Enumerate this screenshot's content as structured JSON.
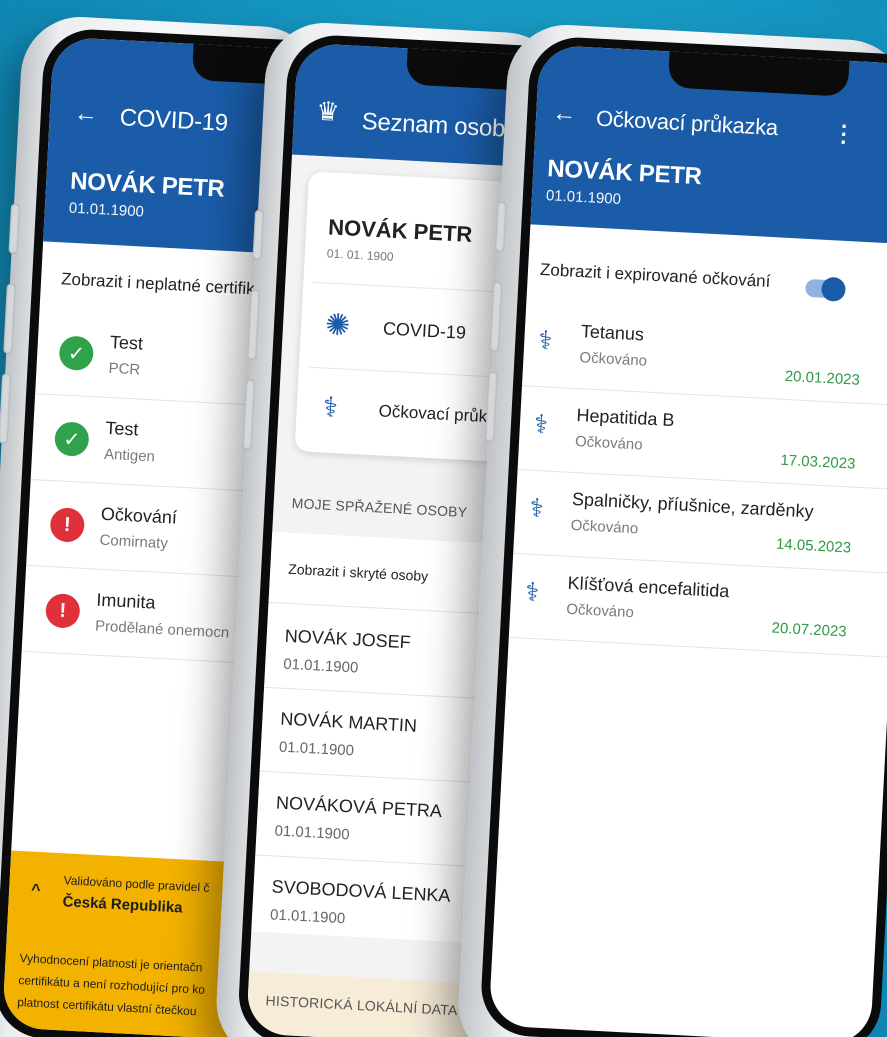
{
  "phone1": {
    "back_icon": "arrow-left-icon",
    "title": "COVID-19",
    "name": "NOVÁK PETR",
    "dob": "01.01.1900",
    "toggle_label": "Zobrazit i neplatné certifik",
    "items": [
      {
        "title": "Test",
        "sub": "PCR",
        "icon": "check-icon",
        "status": "valid"
      },
      {
        "title": "Test",
        "sub": "Antigen",
        "icon": "check-icon",
        "status": "valid"
      },
      {
        "title": "Očkování",
        "sub": "Comirnaty",
        "icon": "warning-icon",
        "status": "invalid"
      },
      {
        "title": "Imunita",
        "sub": "Prodělané onemocn",
        "icon": "warning-icon",
        "status": "invalid"
      }
    ],
    "footer": {
      "chevron": "^",
      "validated_label": "Validováno podle pravidel č",
      "country": "Česká Republika",
      "note_line1": "Vyhodnocení platnosti je orientačn",
      "note_line2": "certifikátu a není rozhodující pro ko",
      "note_line3": "platnost certifikátu vlastní čtečkou"
    }
  },
  "phone2": {
    "logo_icon": "czech-lion-icon",
    "title": "Seznam osob",
    "card": {
      "name": "NOVÁK PETR",
      "dob": "01. 01. 1900",
      "items": [
        {
          "label": "COVID-19",
          "icon": "virus-icon"
        },
        {
          "label": "Očkovací průka",
          "icon": "syringe-icon"
        }
      ]
    },
    "section_linked": "MOJE SPŘAŽENÉ OSOBY",
    "toggle_label": "Zobrazit i skryté osoby",
    "people": [
      {
        "name": "NOVÁK JOSEF",
        "dob": "01.01.1900"
      },
      {
        "name": "NOVÁK MARTIN",
        "dob": "01.01.1900"
      },
      {
        "name": "NOVÁKOVÁ PETRA",
        "dob": "01.01.1900"
      },
      {
        "name": "SVOBODOVÁ LENKA",
        "dob": "01.01.1900"
      }
    ],
    "section_history": "HISTORICKÁ LOKÁLNÍ DATA"
  },
  "phone3": {
    "back_icon": "arrow-left-icon",
    "title": "Očkovací průkazka",
    "menu_icon": "more-vert-icon",
    "name": "NOVÁK PETR",
    "dob": "01.01.1900",
    "toggle_label": "Zobrazit i expirované očkování",
    "toggle_on": true,
    "vaccines": [
      {
        "name": "Tetanus",
        "status": "Očkováno",
        "date": "20.01.2023"
      },
      {
        "name": "Hepatitida B",
        "status": "Očkováno",
        "date": "17.03.2023"
      },
      {
        "name": "Spalničky, příušnice, zarděnky",
        "status": "Očkováno",
        "date": "14.05.2023"
      },
      {
        "name": "Klíšťová encefalitida",
        "status": "Očkováno",
        "date": "20.07.2023"
      }
    ]
  },
  "colors": {
    "app_blue": "#1a5ca8",
    "valid_green": "#31a24c",
    "invalid_red": "#e0303a",
    "footer_yellow": "#f3b200",
    "date_green": "#2e9a43"
  }
}
